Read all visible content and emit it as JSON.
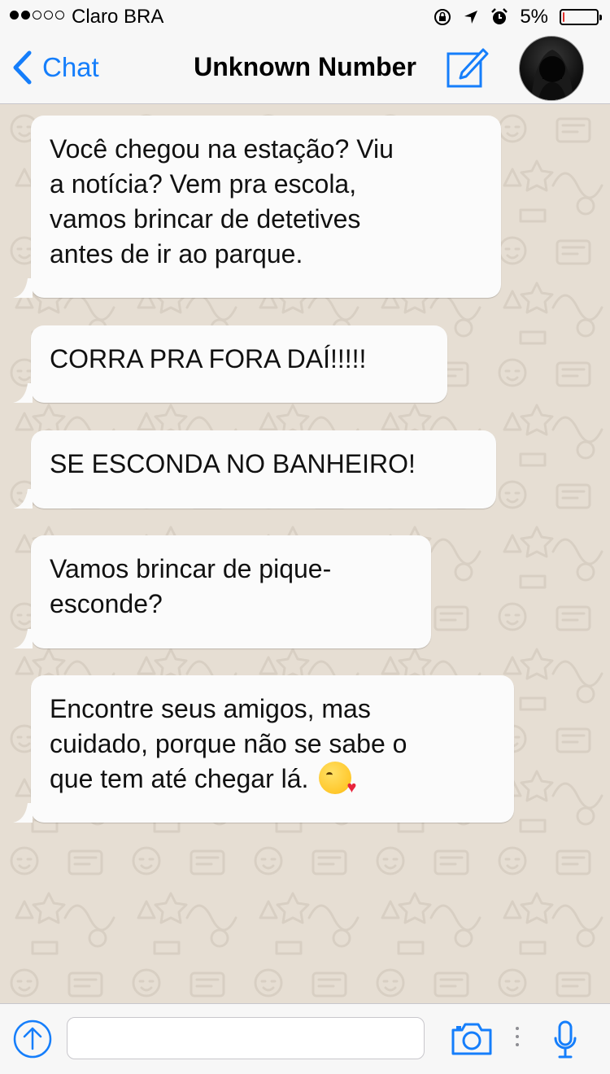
{
  "status_bar": {
    "carrier": "Claro BRA",
    "battery": "5%",
    "battery_level": 0.05,
    "signal_bars": 2,
    "signal_total": 5
  },
  "nav": {
    "back_label": "Chat",
    "title": "Unknown Number"
  },
  "messages": [
    {
      "lines": [
        "Você chegou na estação? Viu",
        "a notícia? Vem pra escola,",
        "vamos brincar de detetives",
        "antes de ir ao parque."
      ]
    },
    {
      "lines": [
        "CORRA PRA FORA DAÍ!!!!!"
      ]
    },
    {
      "lines": [
        "SE ESCONDA NO BANHEIRO!"
      ]
    },
    {
      "lines": [
        "Vamos brincar de pique-",
        "esconde?"
      ]
    },
    {
      "lines": [
        "Encontre seus amigos, mas",
        "cuidado, porque não se sabe o",
        "que tem até chegar lá."
      ],
      "emoji": "face-throwing-kiss-emoji"
    }
  ],
  "input": {
    "value": "",
    "placeholder": ""
  },
  "icons": {
    "back": "chevron-left-icon",
    "compose": "compose-icon",
    "upload": "upload-arrow-icon",
    "camera": "camera-icon",
    "mic": "microphone-icon"
  },
  "colors": {
    "accent": "#157efb",
    "bubble": "#fbfbfb",
    "wallpaper": "#e6ded3",
    "battery_low": "#e0302b"
  }
}
